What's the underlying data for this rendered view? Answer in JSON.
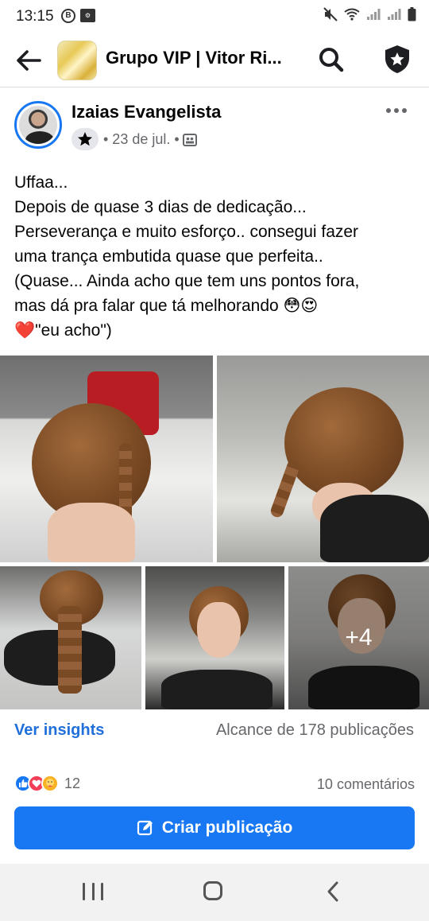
{
  "status_bar": {
    "time": "13:15",
    "left_icons": [
      "b-circle-icon",
      "settings-box-icon"
    ],
    "right_icons": [
      "mute-icon",
      "wifi-icon",
      "signal-icon",
      "signal-icon",
      "battery-icon"
    ]
  },
  "header": {
    "title": "Grupo VIP | Vitor Ri...",
    "back_icon": "arrow-left-icon",
    "search_icon": "search-icon",
    "shield_icon": "shield-star-icon"
  },
  "post": {
    "author": "Izaias Evangelista",
    "badge_icon": "star-icon",
    "date": "• 23 de jul. •",
    "privacy_icon": "group-privacy-icon",
    "more_icon": "more-horizontal-icon",
    "text_lines": [
      "Uffaa...",
      "Depois de quase 3 dias de dedicação...",
      "Perseverança e muito esforço.. consegui fazer",
      "uma trança embutida quase que perfeita..",
      "(Quase... Ainda acho que tem uns pontos fora,",
      "mas dá pra falar que tá melhorando 😳😍",
      "❤️\"eu acho\")"
    ],
    "photos": [
      "photo-braid-back",
      "photo-braid-side",
      "photo-braid-long",
      "photo-mannequin-front",
      "photo-mannequin-extra"
    ],
    "more_photos": "+4"
  },
  "insights": {
    "link": "Ver insights",
    "reach": "Alcance de 178 publicações"
  },
  "engagement": {
    "reaction_icons": [
      "like-reaction-icon",
      "love-reaction-icon",
      "care-reaction-icon"
    ],
    "reaction_count": "12",
    "comments": "10 comentários"
  },
  "create_button": {
    "label": "Criar publicação",
    "icon": "edit-icon"
  },
  "colors": {
    "primary": "#1877f2",
    "link": "#216fdb",
    "secondary_text": "#65676b",
    "divider": "#dadde1"
  }
}
